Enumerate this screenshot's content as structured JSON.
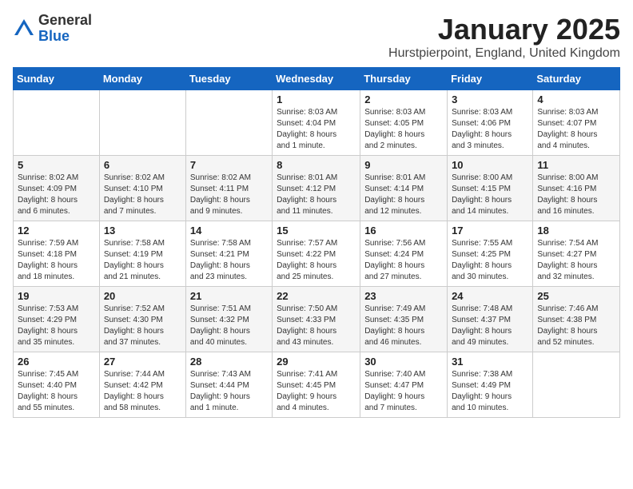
{
  "logo": {
    "general": "General",
    "blue": "Blue"
  },
  "title": "January 2025",
  "location": "Hurstpierpoint, England, United Kingdom",
  "days_header": [
    "Sunday",
    "Monday",
    "Tuesday",
    "Wednesday",
    "Thursday",
    "Friday",
    "Saturday"
  ],
  "weeks": [
    [
      {
        "day": "",
        "info": ""
      },
      {
        "day": "",
        "info": ""
      },
      {
        "day": "",
        "info": ""
      },
      {
        "day": "1",
        "info": "Sunrise: 8:03 AM\nSunset: 4:04 PM\nDaylight: 8 hours\nand 1 minute."
      },
      {
        "day": "2",
        "info": "Sunrise: 8:03 AM\nSunset: 4:05 PM\nDaylight: 8 hours\nand 2 minutes."
      },
      {
        "day": "3",
        "info": "Sunrise: 8:03 AM\nSunset: 4:06 PM\nDaylight: 8 hours\nand 3 minutes."
      },
      {
        "day": "4",
        "info": "Sunrise: 8:03 AM\nSunset: 4:07 PM\nDaylight: 8 hours\nand 4 minutes."
      }
    ],
    [
      {
        "day": "5",
        "info": "Sunrise: 8:02 AM\nSunset: 4:09 PM\nDaylight: 8 hours\nand 6 minutes."
      },
      {
        "day": "6",
        "info": "Sunrise: 8:02 AM\nSunset: 4:10 PM\nDaylight: 8 hours\nand 7 minutes."
      },
      {
        "day": "7",
        "info": "Sunrise: 8:02 AM\nSunset: 4:11 PM\nDaylight: 8 hours\nand 9 minutes."
      },
      {
        "day": "8",
        "info": "Sunrise: 8:01 AM\nSunset: 4:12 PM\nDaylight: 8 hours\nand 11 minutes."
      },
      {
        "day": "9",
        "info": "Sunrise: 8:01 AM\nSunset: 4:14 PM\nDaylight: 8 hours\nand 12 minutes."
      },
      {
        "day": "10",
        "info": "Sunrise: 8:00 AM\nSunset: 4:15 PM\nDaylight: 8 hours\nand 14 minutes."
      },
      {
        "day": "11",
        "info": "Sunrise: 8:00 AM\nSunset: 4:16 PM\nDaylight: 8 hours\nand 16 minutes."
      }
    ],
    [
      {
        "day": "12",
        "info": "Sunrise: 7:59 AM\nSunset: 4:18 PM\nDaylight: 8 hours\nand 18 minutes."
      },
      {
        "day": "13",
        "info": "Sunrise: 7:58 AM\nSunset: 4:19 PM\nDaylight: 8 hours\nand 21 minutes."
      },
      {
        "day": "14",
        "info": "Sunrise: 7:58 AM\nSunset: 4:21 PM\nDaylight: 8 hours\nand 23 minutes."
      },
      {
        "day": "15",
        "info": "Sunrise: 7:57 AM\nSunset: 4:22 PM\nDaylight: 8 hours\nand 25 minutes."
      },
      {
        "day": "16",
        "info": "Sunrise: 7:56 AM\nSunset: 4:24 PM\nDaylight: 8 hours\nand 27 minutes."
      },
      {
        "day": "17",
        "info": "Sunrise: 7:55 AM\nSunset: 4:25 PM\nDaylight: 8 hours\nand 30 minutes."
      },
      {
        "day": "18",
        "info": "Sunrise: 7:54 AM\nSunset: 4:27 PM\nDaylight: 8 hours\nand 32 minutes."
      }
    ],
    [
      {
        "day": "19",
        "info": "Sunrise: 7:53 AM\nSunset: 4:29 PM\nDaylight: 8 hours\nand 35 minutes."
      },
      {
        "day": "20",
        "info": "Sunrise: 7:52 AM\nSunset: 4:30 PM\nDaylight: 8 hours\nand 37 minutes."
      },
      {
        "day": "21",
        "info": "Sunrise: 7:51 AM\nSunset: 4:32 PM\nDaylight: 8 hours\nand 40 minutes."
      },
      {
        "day": "22",
        "info": "Sunrise: 7:50 AM\nSunset: 4:33 PM\nDaylight: 8 hours\nand 43 minutes."
      },
      {
        "day": "23",
        "info": "Sunrise: 7:49 AM\nSunset: 4:35 PM\nDaylight: 8 hours\nand 46 minutes."
      },
      {
        "day": "24",
        "info": "Sunrise: 7:48 AM\nSunset: 4:37 PM\nDaylight: 8 hours\nand 49 minutes."
      },
      {
        "day": "25",
        "info": "Sunrise: 7:46 AM\nSunset: 4:38 PM\nDaylight: 8 hours\nand 52 minutes."
      }
    ],
    [
      {
        "day": "26",
        "info": "Sunrise: 7:45 AM\nSunset: 4:40 PM\nDaylight: 8 hours\nand 55 minutes."
      },
      {
        "day": "27",
        "info": "Sunrise: 7:44 AM\nSunset: 4:42 PM\nDaylight: 8 hours\nand 58 minutes."
      },
      {
        "day": "28",
        "info": "Sunrise: 7:43 AM\nSunset: 4:44 PM\nDaylight: 9 hours\nand 1 minute."
      },
      {
        "day": "29",
        "info": "Sunrise: 7:41 AM\nSunset: 4:45 PM\nDaylight: 9 hours\nand 4 minutes."
      },
      {
        "day": "30",
        "info": "Sunrise: 7:40 AM\nSunset: 4:47 PM\nDaylight: 9 hours\nand 7 minutes."
      },
      {
        "day": "31",
        "info": "Sunrise: 7:38 AM\nSunset: 4:49 PM\nDaylight: 9 hours\nand 10 minutes."
      },
      {
        "day": "",
        "info": ""
      }
    ]
  ]
}
